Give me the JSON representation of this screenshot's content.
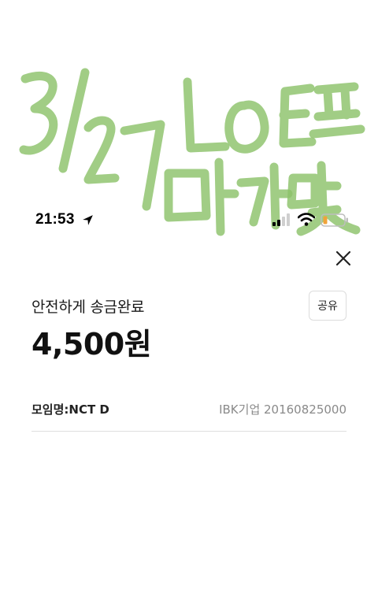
{
  "handwritten_note": {
    "line1": "3/27 LOE프",
    "line2": "마가맞",
    "color": "#8cc26a"
  },
  "status_bar": {
    "time": "21:53",
    "icons": [
      "location-arrow-icon",
      "cellular-signal-icon",
      "wifi-icon",
      "battery-low-icon"
    ],
    "battery_color": "#f0a33a"
  },
  "header": {
    "close_icon": "close-icon"
  },
  "transfer": {
    "status_text": "안전하게 송금완료",
    "amount": "4,500원",
    "share_label": "공유"
  },
  "recipient": {
    "name": "모임명:NCT D",
    "account": "IBK기업 20160825000"
  }
}
